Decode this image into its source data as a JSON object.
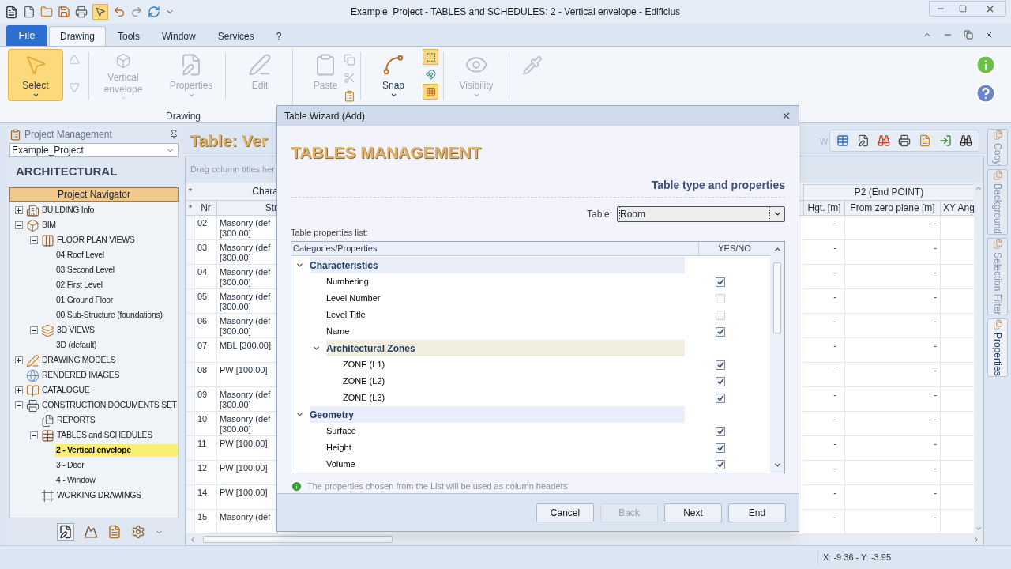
{
  "window": {
    "title": "Example_Project -  TABLES and SCHEDULES: 2 - Vertical envelope - Edificius"
  },
  "ribbon_tabs": [
    {
      "label": "File",
      "kind": "file",
      "selected": false
    },
    {
      "label": "Drawing",
      "kind": "tab",
      "selected": true
    },
    {
      "label": "Tools",
      "kind": "tab",
      "selected": false
    },
    {
      "label": "Window",
      "kind": "tab",
      "selected": false
    },
    {
      "label": "Services",
      "kind": "tab",
      "selected": false
    },
    {
      "label": "?",
      "kind": "tab",
      "selected": false
    }
  ],
  "ribbon": {
    "group_label": "Drawing",
    "buttons": [
      {
        "label": "Select",
        "kind": "select",
        "selected": true,
        "disabled": false,
        "dropdown": true
      },
      {
        "label": "Vertical envelope",
        "kind": "envelope",
        "selected": false,
        "disabled": true,
        "dropdown": true
      },
      {
        "label": "Properties",
        "kind": "properties",
        "selected": false,
        "disabled": true,
        "dropdown": true
      },
      {
        "label": "Edit",
        "kind": "edit",
        "selected": false,
        "disabled": true,
        "dropdown": false
      },
      {
        "label": "Paste",
        "kind": "paste",
        "selected": false,
        "disabled": true,
        "dropdown": false
      },
      {
        "label": "Snap",
        "kind": "snap",
        "selected": false,
        "disabled": false,
        "dropdown": true
      },
      {
        "label": "Visibility",
        "kind": "visibility",
        "selected": false,
        "disabled": true,
        "dropdown": true
      }
    ],
    "snap_modes": [
      {
        "on": true
      },
      {
        "on": false
      },
      {
        "on": true
      }
    ]
  },
  "project_panel": {
    "title": "Project Management",
    "project": "Example_Project",
    "heading": "ARCHITECTURAL",
    "navigator": "Project Navigator",
    "tree": [
      {
        "label": "BUILDING Info",
        "kind": "building",
        "expanded": false,
        "selected": false
      },
      {
        "label": "BIM",
        "kind": "bim",
        "expanded": true,
        "selected": false,
        "children": [
          {
            "label": "FLOOR PLAN VIEWS",
            "kind": "floorplan",
            "expanded": true,
            "selected": false,
            "children": [
              {
                "label": "04 Roof Level",
                "selected": false
              },
              {
                "label": "03 Second Level",
                "selected": false
              },
              {
                "label": "02 First Level",
                "selected": false
              },
              {
                "label": "01 Ground Floor",
                "selected": false
              },
              {
                "label": "00 Sub-Structure (foundations)",
                "selected": false
              }
            ]
          },
          {
            "label": "3D VIEWS",
            "kind": "views3d",
            "expanded": true,
            "selected": false,
            "children": [
              {
                "label": "3D (default)",
                "selected": false
              }
            ]
          }
        ]
      },
      {
        "label": "DRAWING MODELS",
        "kind": "drawing",
        "expanded": false,
        "selected": false
      },
      {
        "label": "RENDERED IMAGES",
        "kind": "render",
        "selected": false
      },
      {
        "label": "CATALOGUE",
        "kind": "catalogue",
        "expanded": false,
        "selected": false
      },
      {
        "label": "CONSTRUCTION DOCUMENTS SET",
        "kind": "docs",
        "expanded": true,
        "selected": false,
        "children": [
          {
            "label": "REPORTS",
            "kind": "reports",
            "selected": false
          },
          {
            "label": "TABLES and SCHEDULES",
            "kind": "tables",
            "expanded": true,
            "selected": false,
            "children": [
              {
                "label": "2 - Vertical envelope",
                "selected": true
              },
              {
                "label": "3 - Door",
                "selected": false
              },
              {
                "label": "4 - Window",
                "selected": false
              }
            ]
          },
          {
            "label": "WORKING DRAWINGS",
            "kind": "working",
            "selected": false
          }
        ]
      }
    ]
  },
  "document": {
    "title": "Table: Ver",
    "title_tail": "w",
    "group_hint": "Drag column titles her",
    "table": {
      "group_headers": [
        "Chara",
        "P2 (End POINT)"
      ],
      "markers": [
        "*",
        "*"
      ],
      "columns": [
        "Nr",
        "Str",
        "Hgt. [m]",
        "From zero plane [m]",
        "XY Ang"
      ],
      "rows": [
        {
          "cells": [
            "02",
            "Masonry (def\n[300.00]",
            "-",
            "-"
          ]
        },
        {
          "cells": [
            "03",
            "Masonry (def\n[300.00]",
            "-",
            "-"
          ]
        },
        {
          "cells": [
            "04",
            "Masonry (def\n[300.00]",
            "-",
            "-"
          ]
        },
        {
          "cells": [
            "05",
            "Masonry (def\n[300.00]",
            "-",
            "-"
          ]
        },
        {
          "cells": [
            "06",
            "Masonry (def\n[300.00]",
            "-",
            "-"
          ]
        },
        {
          "cells": [
            "07",
            "MBL [300.00]",
            "-",
            "-"
          ]
        },
        {
          "cells": [
            "08",
            "PW [100.00]",
            "-",
            "-"
          ]
        },
        {
          "cells": [
            "09",
            "Masonry (def\n[300.00]",
            "-",
            "-"
          ]
        },
        {
          "cells": [
            "10",
            "Masonry (def\n[300.00]",
            "-",
            "-"
          ]
        },
        {
          "cells": [
            "11",
            "PW [100.00]",
            "-",
            "-"
          ]
        },
        {
          "cells": [
            "12",
            "PW [100.00]",
            "-",
            "-"
          ]
        },
        {
          "cells": [
            "14",
            "PW [100.00]",
            "-",
            "-"
          ]
        },
        {
          "cells": [
            "15",
            "Masonry (def",
            "-",
            "-"
          ]
        }
      ]
    }
  },
  "side_tabs": [
    {
      "label": "Copy",
      "selected": false
    },
    {
      "label": "Background",
      "selected": false
    },
    {
      "label": "Selection Filter",
      "selected": false
    },
    {
      "label": "Properties",
      "selected": true
    }
  ],
  "status_bar": {
    "coordinates": "X: -9.36 - Y: -3.95"
  },
  "dialog": {
    "title": "Table Wizard (Add)",
    "heading": "TABLES MANAGEMENT",
    "subheading": "Table type and properties",
    "table_label": "Table:",
    "table_value": "Room",
    "list_label": "Table properties list:",
    "columns": [
      "Categories/Properties",
      "YES/NO"
    ],
    "tree": [
      {
        "label": "Characteristics",
        "kind": "category",
        "expanded": true,
        "children": [
          {
            "label": "Numbering",
            "kind": "property",
            "checked": true
          },
          {
            "label": "Level Number",
            "kind": "property",
            "checked": false
          },
          {
            "label": "Level Title",
            "kind": "property",
            "checked": false
          },
          {
            "label": "Name",
            "kind": "property",
            "checked": true
          },
          {
            "label": "Architectural Zones",
            "kind": "category",
            "expanded": true,
            "children": [
              {
                "label": "ZONE (L1)",
                "kind": "property",
                "checked": true
              },
              {
                "label": "ZONE (L2)",
                "kind": "property",
                "checked": true
              },
              {
                "label": "ZONE (L3)",
                "kind": "property",
                "checked": true
              }
            ]
          }
        ]
      },
      {
        "label": "Geometry",
        "kind": "category",
        "expanded": true,
        "children": [
          {
            "label": "Surface",
            "kind": "property",
            "checked": true
          },
          {
            "label": "Height",
            "kind": "property",
            "checked": true
          },
          {
            "label": "Volume",
            "kind": "property",
            "checked": true
          }
        ]
      }
    ],
    "hint": "The properties chosen from the List will be used as column headers",
    "buttons": [
      {
        "label": "Cancel",
        "disabled": false
      },
      {
        "label": "Back",
        "disabled": true
      },
      {
        "label": "Next",
        "disabled": false
      },
      {
        "label": "End",
        "disabled": false
      }
    ]
  }
}
